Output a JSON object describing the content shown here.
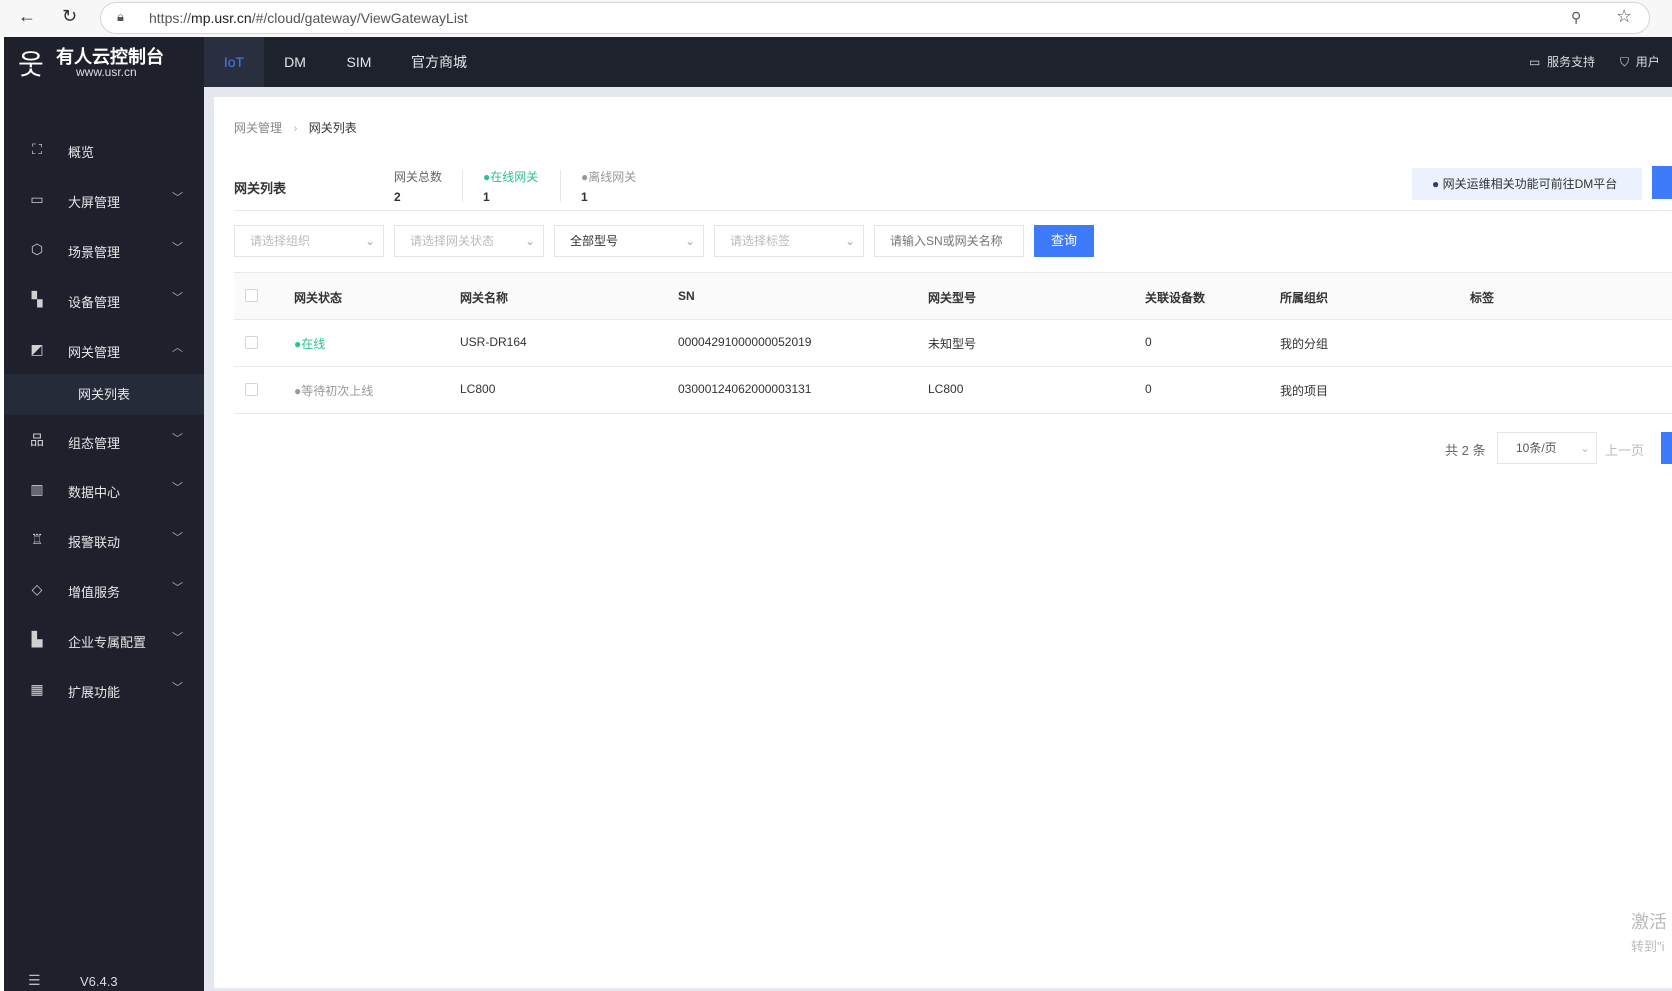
{
  "browser": {
    "url_prefix": "https://",
    "url_host": "mp.usr.cn",
    "url_path": "/#/cloud/gateway/ViewGatewayList"
  },
  "logo": {
    "title": "有人云控制台",
    "subtitle": "www.usr.cn"
  },
  "topnav": {
    "tabs": [
      {
        "label": "IoT",
        "active": true
      },
      {
        "label": "DM"
      },
      {
        "label": "SIM"
      },
      {
        "label": "官方商城"
      }
    ],
    "support": "服务支持",
    "user": "用户"
  },
  "sidebar": {
    "items": [
      {
        "label": "概览",
        "icon": "scan-icon"
      },
      {
        "label": "大屏管理",
        "icon": "monitor-icon"
      },
      {
        "label": "场景管理",
        "icon": "cube-icon"
      },
      {
        "label": "设备管理",
        "icon": "grid-icon"
      },
      {
        "label": "网关管理",
        "icon": "chart-icon",
        "expanded": true
      },
      {
        "label": "组态管理",
        "icon": "hierarchy-icon"
      },
      {
        "label": "数据中心",
        "icon": "bar-chart-icon"
      },
      {
        "label": "报警联动",
        "icon": "alarm-icon"
      },
      {
        "label": "增值服务",
        "icon": "diamond-icon"
      },
      {
        "label": "企业专属配置",
        "icon": "building-icon"
      },
      {
        "label": "扩展功能",
        "icon": "apps-icon"
      }
    ],
    "sub_item": "网关列表",
    "version": "V6.4.3"
  },
  "breadcrumb": [
    "网关管理",
    "网关列表"
  ],
  "header": {
    "title": "网关列表",
    "stats": [
      {
        "label": "网关总数",
        "value": "2"
      },
      {
        "label": "在线网关",
        "value": "1",
        "color": "#2ec28b"
      },
      {
        "label": "离线网关",
        "value": "1",
        "color": "#999999"
      }
    ],
    "notice": "网关运维相关功能可前往DM平台"
  },
  "filters": {
    "org": "请选择组织",
    "status": "请选择网关状态",
    "model": "全部型号",
    "tag": "请选择标签",
    "search_placeholder": "请输入SN或网关名称",
    "query": "查询"
  },
  "table": {
    "columns": [
      "网关状态",
      "网关名称",
      "SN",
      "网关型号",
      "关联设备数",
      "所属组织",
      "标签"
    ],
    "rows": [
      {
        "status": "在线",
        "status_color": "#2ec28b",
        "name": "USR-DR164",
        "sn": "00004291000000052019",
        "model": "未知型号",
        "devices": "0",
        "org": "我的分组",
        "tag": ""
      },
      {
        "status": "等待初次上线",
        "status_color": "#999999",
        "name": "LC800",
        "sn": "03000124062000003131",
        "model": "LC800",
        "devices": "0",
        "org": "我的项目",
        "tag": ""
      }
    ]
  },
  "pagination": {
    "total": "共 2 条",
    "page_size": "10条/页",
    "prev": "上一页"
  },
  "watermark": {
    "line1": "激活",
    "line2": "转到\"i"
  },
  "colors": {
    "accent": "#3e7bfa",
    "sidebar": "#1e202b",
    "online": "#2ec28b"
  }
}
